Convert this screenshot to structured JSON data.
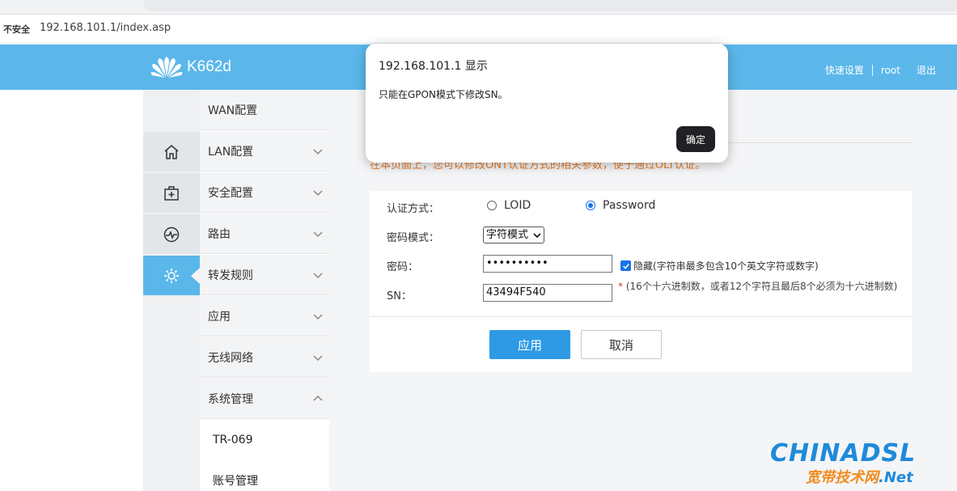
{
  "browser": {
    "security_label": "不安全",
    "url": "192.168.101.1/index.asp"
  },
  "header": {
    "model": "K662d",
    "links": [
      "快速设置",
      "root",
      "退出"
    ],
    "color": "#5bb7ea"
  },
  "icon_column": {
    "icons": [
      "home-icon",
      "medical-kit-icon",
      "activity-icon",
      "gear-icon"
    ],
    "active_index": 3
  },
  "menu": {
    "items": [
      {
        "label": "WAN配置",
        "has_chevron": false
      },
      {
        "label": "LAN配置",
        "has_chevron": true
      },
      {
        "label": "安全配置",
        "has_chevron": true
      },
      {
        "label": "路由",
        "has_chevron": true
      },
      {
        "label": "转发规则",
        "has_chevron": true
      },
      {
        "label": "应用",
        "has_chevron": true
      },
      {
        "label": "无线网络",
        "has_chevron": true
      },
      {
        "label": "系统管理",
        "has_chevron": true,
        "expanded": true
      }
    ],
    "sub_items": [
      "TR-069",
      "账号管理"
    ]
  },
  "content": {
    "notice": "在本页面上，您可以修改ONT认证方式的相关参数，便于通过OLT认证。",
    "form": {
      "auth_label": "认证方式：",
      "auth_options": [
        "LOID",
        "Password"
      ],
      "auth_selected": "Password",
      "pwd_mode_label": "密码模式：",
      "pwd_mode_value": "字符模式",
      "password_label": "密码：",
      "password_value": "••••••••••",
      "hide_label": "隐藏(字符串最多包含10个英文字符或数字)",
      "hide_checked": true,
      "sn_label": "SN：",
      "sn_value": "43494F540",
      "sn_star": "*",
      "sn_hint": "(16个十六进制数，或者12个字符且最后8个必须为十六进制数)",
      "apply_label": "应用",
      "cancel_label": "取消"
    }
  },
  "dialog": {
    "title": "192.168.101.1 显示",
    "message": "只能在GPON模式下修改SN。",
    "ok_label": "确定"
  },
  "watermark": {
    "main": "CHINADSL",
    "sub": "宽带技术网",
    "sub_suffix": ".Net"
  }
}
